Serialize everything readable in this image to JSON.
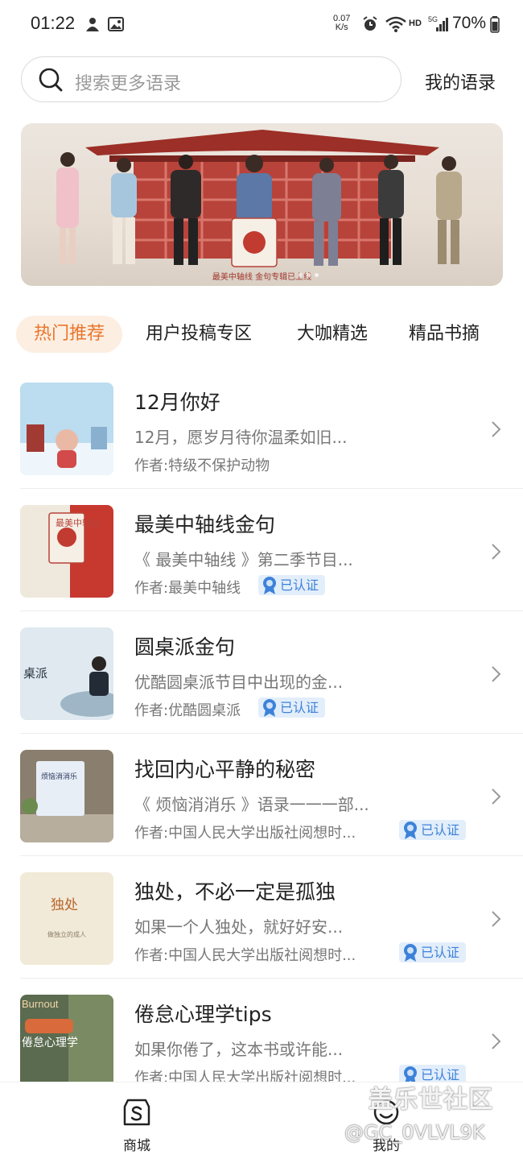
{
  "status_bar": {
    "time": "01:22",
    "net_speed_value": "0.07",
    "net_speed_unit": "K/s",
    "hd": "HD",
    "signal_label": "5G",
    "battery": "70%"
  },
  "search": {
    "placeholder": "搜索更多语录",
    "my_quotes_link": "我的语录"
  },
  "banner": {
    "caption": "最美中轴线 金句专辑已上线"
  },
  "tabs": [
    {
      "label": "热门推荐",
      "active": true
    },
    {
      "label": "用户投稿专区",
      "active": false
    },
    {
      "label": "大咖精选",
      "active": false
    },
    {
      "label": "精品书摘",
      "active": false
    }
  ],
  "list": [
    {
      "title": "12月你好",
      "desc": "12月，愿岁月待你温柔如旧...",
      "author": "作者:特级不保护动物",
      "verified": false
    },
    {
      "title": "最美中轴线金句",
      "desc": "《 最美中轴线 》第二季节目...",
      "author": "作者:最美中轴线",
      "verified": true,
      "badge": "已认证"
    },
    {
      "title": "圆桌派金句",
      "desc": "优酷圆桌派节目中出现的金...",
      "author": "作者:优酷圆桌派",
      "verified": true,
      "badge": "已认证"
    },
    {
      "title": "找回内心平静的秘密",
      "desc": "《 烦恼消消乐 》语录一一一部...",
      "author": "作者:中国人民大学出版社阅想时...",
      "verified": true,
      "badge": "已认证"
    },
    {
      "title": "独处，不必一定是孤独",
      "desc": "如果一个人独处，就好好安...",
      "author": "作者:中国人民大学出版社阅想时...",
      "verified": true,
      "badge": "已认证"
    },
    {
      "title": "倦怠心理学tips",
      "desc": "如果你倦了，这本书或许能...",
      "author": "作者:中国人民大学出版社阅想时...",
      "verified": true,
      "badge": "已认证"
    }
  ],
  "thumbs": {
    "t2_title": "最美中轴线",
    "t3_title": "桌派",
    "t4_title": "烦恼消消乐",
    "t5_title": "独处",
    "t5_sub": "做独立的成人",
    "t6_title": "倦怠心理学",
    "t6_en": "Burnout"
  },
  "bottom_nav": {
    "items": [
      {
        "label": "商城",
        "icon": "shop-icon"
      },
      {
        "label": "我的",
        "icon": "profile-icon"
      }
    ]
  },
  "watermark": {
    "line1": "盖乐世社区",
    "line2": "@GC_0VLVL9K"
  },
  "colors": {
    "accent": "#e8762c",
    "tab_active_bg": "#fdeee2",
    "verified": "#3d82d9",
    "verified_bg": "#e3eefb"
  }
}
